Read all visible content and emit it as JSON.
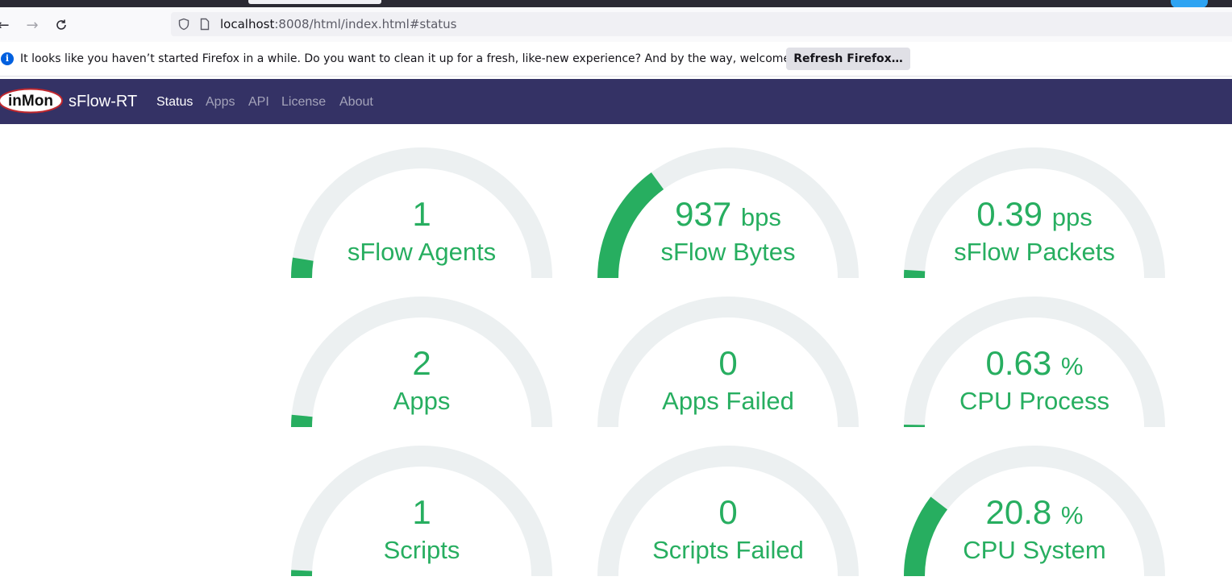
{
  "browser": {
    "url_host": "localhost",
    "url_rest": ":8008/html/index.html#status",
    "back_icon": "arrow-left-icon",
    "forward_icon": "arrow-right-icon",
    "reload_icon": "reload-icon"
  },
  "infobar": {
    "message": "It looks like you haven’t started Firefox in a while. Do you want to clean it up for a fresh, like-new experience? And by the way, welcome back!",
    "button": "Refresh Firefox…"
  },
  "app": {
    "logo_text": "inMon",
    "brand": "sFlow-RT",
    "nav": [
      {
        "label": "Status",
        "active": true
      },
      {
        "label": "Apps",
        "active": false
      },
      {
        "label": "API",
        "active": false
      },
      {
        "label": "License",
        "active": false
      },
      {
        "label": "About",
        "active": false
      }
    ]
  },
  "colors": {
    "accent": "#27ae60",
    "track": "#ecf0f1",
    "navbar": "#343265"
  },
  "gauges": [
    {
      "value": "1",
      "unit": "",
      "label": "sFlow Agents",
      "fill": 0.05
    },
    {
      "value": "937",
      "unit": "bps",
      "label": "sFlow Bytes",
      "fill": 0.3
    },
    {
      "value": "0.39",
      "unit": "pps",
      "label": "sFlow Packets",
      "fill": 0.02
    },
    {
      "value": "2",
      "unit": "",
      "label": "Apps",
      "fill": 0.03
    },
    {
      "value": "0",
      "unit": "",
      "label": "Apps Failed",
      "fill": 0
    },
    {
      "value": "0.63",
      "unit": "%",
      "label": "CPU Process",
      "fill": 0.006
    },
    {
      "value": "1",
      "unit": "",
      "label": "Scripts",
      "fill": 0.015
    },
    {
      "value": "0",
      "unit": "",
      "label": "Scripts Failed",
      "fill": 0
    },
    {
      "value": "20.8",
      "unit": "%",
      "label": "CPU System",
      "fill": 0.208
    }
  ]
}
